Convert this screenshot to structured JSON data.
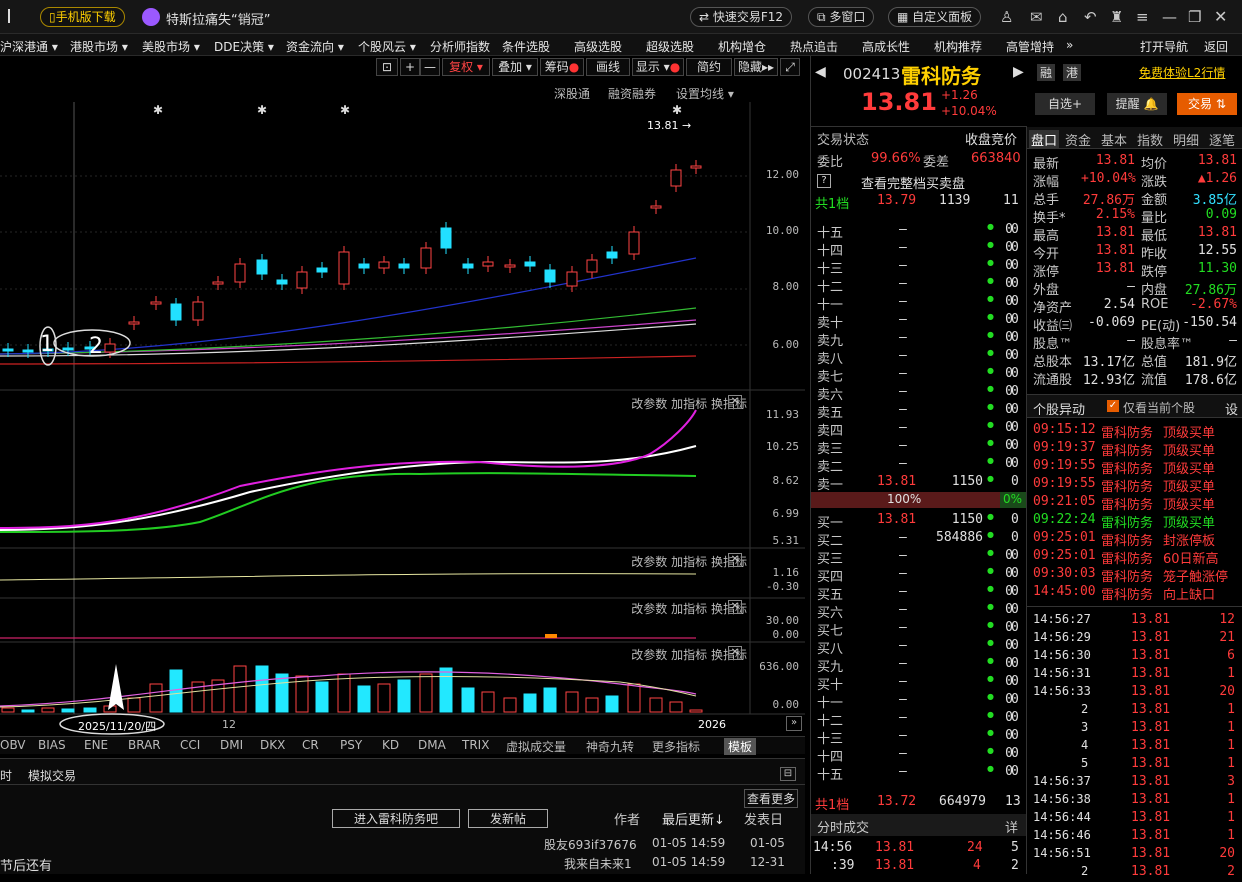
{
  "topbar": {
    "mobile_download": "手机版下载",
    "news": "特斯拉痛失“销冠”",
    "quick_trade": "快速交易F12",
    "multi_window": "多窗口",
    "custom_panel": "自定义面板"
  },
  "menu": [
    "沪深港通 ▾",
    "港股市场 ▾",
    "美股市场 ▾",
    "DDE决策 ▾",
    "资金流向 ▾",
    "个股风云 ▾",
    "分析师指数",
    "条件选股",
    "高级选股",
    "超级选股",
    "机构增仓",
    "热点追击",
    "高成长性",
    "机构推荐",
    "高管增持",
    "»",
    "打开导航",
    "返回"
  ],
  "chart_toolbar": {
    "fuquan": "复权",
    "overlay": "叠加",
    "chips": "筹码",
    "draw": "画线",
    "display": "显示",
    "simple": "简约",
    "hide": "隐藏"
  },
  "chart_links": {
    "sgt": "深股通",
    "margin": "融资融券",
    "ma_setting": "设置均线"
  },
  "last_price_tag": "13.81",
  "price_axis": [
    "12.00",
    "10.00",
    "8.00",
    "6.00"
  ],
  "annotations": {
    "a1": "1",
    "a2": "2",
    "date": "2025/11/20/四",
    "month": "12",
    "year": "2026"
  },
  "panel_links": {
    "params": "改参数",
    "add": "加指标",
    "swap": "换指标"
  },
  "p1_axis": [
    "11.93",
    "10.25",
    "8.62",
    "6.99",
    "5.31"
  ],
  "p2_axis": [
    "1.16",
    "-0.30"
  ],
  "p3_axis": [
    "30.00",
    "0.00"
  ],
  "p4_axis": [
    "636.00",
    "0.00"
  ],
  "indicator_tabs": [
    "OBV",
    "BIAS",
    "ENE",
    "BRAR",
    "CCI",
    "DMI",
    "DKX",
    "CR",
    "PSY",
    "KD",
    "DMA",
    "TRIX",
    "虚拟成交量",
    "神奇九转",
    "更多指标",
    "模板"
  ],
  "bottom": {
    "tab1": "时",
    "tab2": "模拟交易",
    "view_more": "查看更多",
    "enter_bar": "进入雷科防务吧",
    "post": "发新帖",
    "author": "作者",
    "last_update": "最后更新↓",
    "post_date": "发表日",
    "rows": [
      {
        "author": "股友693if37676",
        "update": "01-05 14:59",
        "date": "01-05"
      },
      {
        "author": "我来自未来1",
        "update": "01-05 14:59",
        "date": "12-31"
      }
    ],
    "snippet": "节后还有"
  },
  "stock": {
    "code": "002413",
    "name": "雷科防务",
    "price": "13.81",
    "change": "+1.26",
    "pct": "+10.04%",
    "tag1": "融",
    "tag2": "港",
    "l2": "免费体验L2行情",
    "watch": "自选+",
    "alert": "提醒",
    "trade": "交易"
  },
  "status": {
    "label": "交易状态",
    "value": "收盘竞价",
    "weibi_l": "委比",
    "weibi": "99.66%",
    "weicha_l": "委差",
    "weicha": "663840",
    "full_book": "查看完整档买卖盘"
  },
  "book_top": {
    "label": "共1档",
    "price": "13.79",
    "vol": "1139",
    "n": "11"
  },
  "book_bottom": {
    "label": "共1档",
    "price": "13.72",
    "vol": "664979",
    "n": "13"
  },
  "sells": [
    [
      "十五",
      "—",
      "0",
      "0"
    ],
    [
      "十四",
      "—",
      "0",
      "0"
    ],
    [
      "十三",
      "—",
      "0",
      "0"
    ],
    [
      "十二",
      "—",
      "0",
      "0"
    ],
    [
      "十一",
      "—",
      "0",
      "0"
    ],
    [
      "卖十",
      "—",
      "0",
      "0"
    ],
    [
      "卖九",
      "—",
      "0",
      "0"
    ],
    [
      "卖八",
      "—",
      "0",
      "0"
    ],
    [
      "卖七",
      "—",
      "0",
      "0"
    ],
    [
      "卖六",
      "—",
      "0",
      "0"
    ],
    [
      "卖五",
      "—",
      "0",
      "0"
    ],
    [
      "卖四",
      "—",
      "0",
      "0"
    ],
    [
      "卖三",
      "—",
      "0",
      "0"
    ],
    [
      "卖二",
      "—",
      "0",
      "0"
    ],
    [
      "卖一",
      "13.81",
      "1150",
      "0"
    ]
  ],
  "ratio": {
    "left": "100%",
    "right": "0%"
  },
  "buys": [
    [
      "买一",
      "13.81",
      "1150",
      "0"
    ],
    [
      "买二",
      "—",
      "584886",
      "0"
    ],
    [
      "买三",
      "—",
      "0",
      "0"
    ],
    [
      "买四",
      "—",
      "0",
      "0"
    ],
    [
      "买五",
      "—",
      "0",
      "0"
    ],
    [
      "买六",
      "—",
      "0",
      "0"
    ],
    [
      "买七",
      "—",
      "0",
      "0"
    ],
    [
      "买八",
      "—",
      "0",
      "0"
    ],
    [
      "买九",
      "—",
      "0",
      "0"
    ],
    [
      "买十",
      "—",
      "0",
      "0"
    ],
    [
      "十一",
      "—",
      "0",
      "0"
    ],
    [
      "十二",
      "—",
      "0",
      "0"
    ],
    [
      "十三",
      "—",
      "0",
      "0"
    ],
    [
      "十四",
      "—",
      "0",
      "0"
    ],
    [
      "十五",
      "—",
      "0",
      "0"
    ]
  ],
  "fenshi": {
    "label": "分时成交",
    "detail": "详",
    "rows": [
      [
        "14:56",
        "13.81",
        "24",
        "5"
      ],
      [
        ":39",
        "13.81",
        "4",
        "2"
      ]
    ]
  },
  "quote_tabs": [
    "盘口",
    "资金",
    "基本",
    "指数",
    "明细",
    "逐笔"
  ],
  "quote": [
    [
      "最新",
      "13.81",
      "均价",
      "13.81"
    ],
    [
      "涨幅",
      "+10.04%",
      "涨跌",
      "▲1.26"
    ],
    [
      "总手",
      "27.86万",
      "金额",
      "3.85亿"
    ],
    [
      "换手*",
      "2.15%",
      "量比",
      "0.09"
    ],
    [
      "最高",
      "13.81",
      "最低",
      "13.81"
    ],
    [
      "今开",
      "13.81",
      "昨收",
      "12.55"
    ],
    [
      "涨停",
      "13.81",
      "跌停",
      "11.30"
    ],
    [
      "外盘",
      "—",
      "内盘",
      "27.86万"
    ],
    [
      "净资产",
      "2.54",
      "ROE",
      "-2.67%"
    ],
    [
      "收益㈢",
      "-0.069",
      "PE(动)",
      "-150.54"
    ],
    [
      "股息™",
      "—",
      "股息率™",
      "—"
    ],
    [
      "总股本",
      "13.17亿",
      "总值",
      "181.9亿"
    ],
    [
      "流通股",
      "12.93亿",
      "流值",
      "178.6亿"
    ]
  ],
  "movement": {
    "title": "个股异动",
    "only": "仅看当前个股",
    "set": "设",
    "rows": [
      [
        "09:15:12",
        "雷科防务",
        "顶级买单"
      ],
      [
        "09:19:37",
        "雷科防务",
        "顶级买单"
      ],
      [
        "09:19:55",
        "雷科防务",
        "顶级买单"
      ],
      [
        "09:19:55",
        "雷科防务",
        "顶级买单"
      ],
      [
        "09:21:05",
        "雷科防务",
        "顶级买单"
      ],
      [
        "09:22:24",
        "雷科防务",
        "顶级买单"
      ],
      [
        "09:25:01",
        "雷科防务",
        "封涨停板"
      ],
      [
        "09:25:01",
        "雷科防务",
        "60日新高"
      ],
      [
        "09:30:03",
        "雷科防务",
        "笼子触涨停"
      ],
      [
        "14:45:00",
        "雷科防务",
        "向上缺口"
      ]
    ]
  },
  "ticks": [
    [
      "14:56:27",
      "13.81",
      "12"
    ],
    [
      "14:56:29",
      "13.81",
      "21"
    ],
    [
      "14:56:30",
      "13.81",
      "6"
    ],
    [
      "14:56:31",
      "13.81",
      "1"
    ],
    [
      "14:56:33",
      "13.81",
      "20"
    ],
    [
      "2",
      "13.81",
      "1"
    ],
    [
      "3",
      "13.81",
      "1"
    ],
    [
      "4",
      "13.81",
      "1"
    ],
    [
      "5",
      "13.81",
      "1"
    ],
    [
      "14:56:37",
      "13.81",
      "3"
    ],
    [
      "14:56:38",
      "13.81",
      "1"
    ],
    [
      "14:56:44",
      "13.81",
      "1"
    ],
    [
      "14:56:46",
      "13.81",
      "1"
    ],
    [
      "14:56:51",
      "13.81",
      "20"
    ],
    [
      "2",
      "13.81",
      "2"
    ]
  ]
}
